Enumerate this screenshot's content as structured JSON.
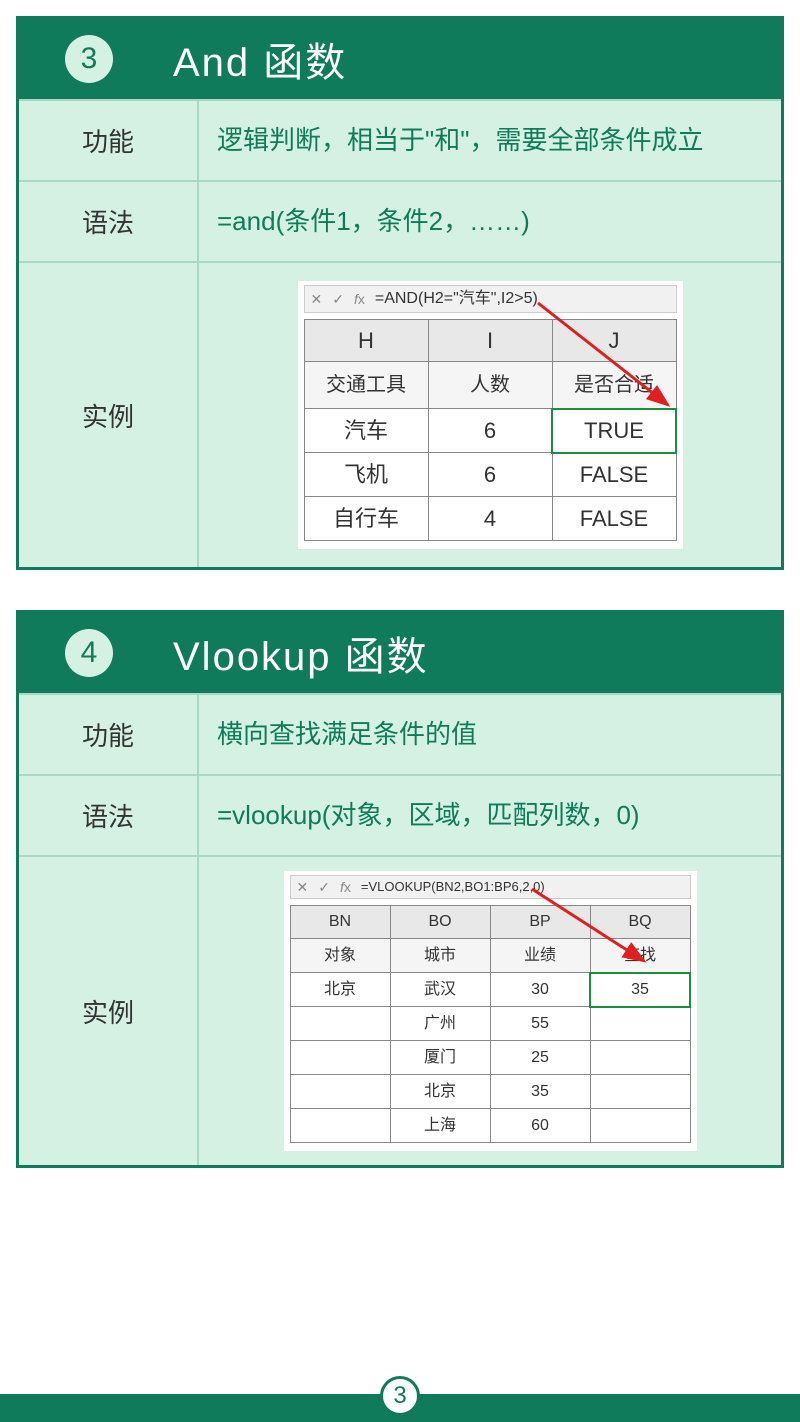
{
  "footer_page": "3",
  "cards": [
    {
      "badge": "3",
      "title": "And 函数",
      "func_label": "功能",
      "func_text": "逻辑判断，相当于\"和\"，需要全部条件成立",
      "syntax_label": "语法",
      "syntax_text": "=and(条件1，条件2，……)",
      "example_label": "实例",
      "formula": "=AND(H2=\"汽车\",I2>5)",
      "col_headers": [
        "H",
        "I",
        "J"
      ],
      "table_headers": [
        "交通工具",
        "人数",
        "是否合适"
      ],
      "rows": [
        [
          "汽车",
          "6",
          "TRUE"
        ],
        [
          "飞机",
          "6",
          "FALSE"
        ],
        [
          "自行车",
          "4",
          "FALSE"
        ]
      ]
    },
    {
      "badge": "4",
      "title": "Vlookup 函数",
      "func_label": "功能",
      "func_text": "横向查找满足条件的值",
      "syntax_label": "语法",
      "syntax_text": "=vlookup(对象，区域，匹配列数，0)",
      "example_label": "实例",
      "formula": "=VLOOKUP(BN2,BO1:BP6,2,0)",
      "col_headers": [
        "BN",
        "BO",
        "BP",
        "BQ"
      ],
      "table_headers": [
        "对象",
        "城市",
        "业绩",
        "查找"
      ],
      "rows": [
        [
          "北京",
          "武汉",
          "30",
          "35"
        ],
        [
          "",
          "广州",
          "55",
          ""
        ],
        [
          "",
          "厦门",
          "25",
          ""
        ],
        [
          "",
          "北京",
          "35",
          ""
        ],
        [
          "",
          "上海",
          "60",
          ""
        ]
      ]
    }
  ]
}
